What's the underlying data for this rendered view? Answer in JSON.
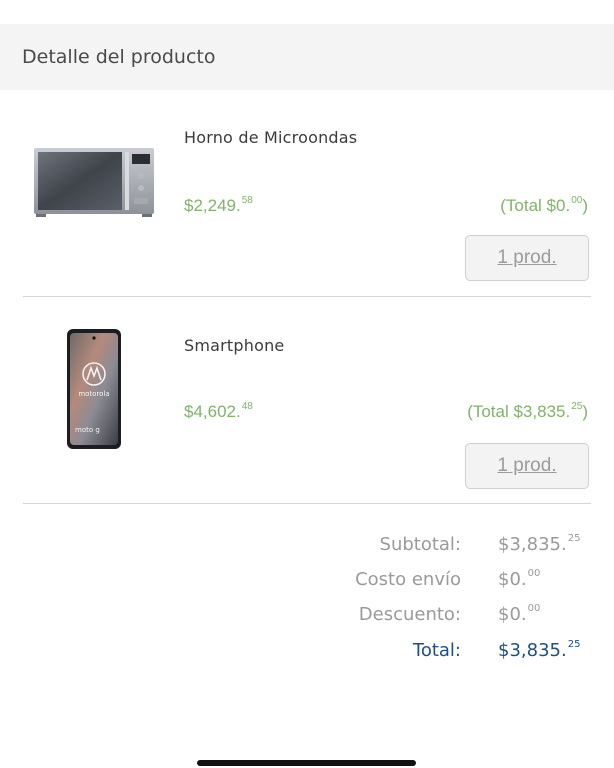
{
  "header": {
    "title": "Detalle del producto"
  },
  "products": [
    {
      "name": "Horno de Microondas",
      "price_main": "$2,249.",
      "price_cents": "58",
      "total_main": "(Total $0.",
      "total_cents": "00",
      "total_close": ")",
      "qty_label": "1 prod.",
      "icon": "microwave-image"
    },
    {
      "name": "Smartphone",
      "price_main": "$4,602.",
      "price_cents": "48",
      "total_main": "(Total $3,835.",
      "total_cents": "25",
      "total_close": ")",
      "qty_label": "1 prod.",
      "icon": "smartphone-image",
      "phone_brand": "motorola",
      "phone_model": "moto g"
    }
  ],
  "summary": {
    "subtotal_label": "Subtotal:",
    "subtotal_main": "$3,835.",
    "subtotal_cents": "25",
    "shipping_label": "Costo envío",
    "shipping_main": "$0.",
    "shipping_cents": "00",
    "discount_label": "Descuento:",
    "discount_main": "$0.",
    "discount_cents": "00",
    "total_label": "Total:",
    "total_main": "$3,835.",
    "total_cents": "25"
  },
  "colors": {
    "price_green": "#7fb36b",
    "total_blue": "#1e4f86",
    "muted_gray": "#9a9a9a"
  }
}
